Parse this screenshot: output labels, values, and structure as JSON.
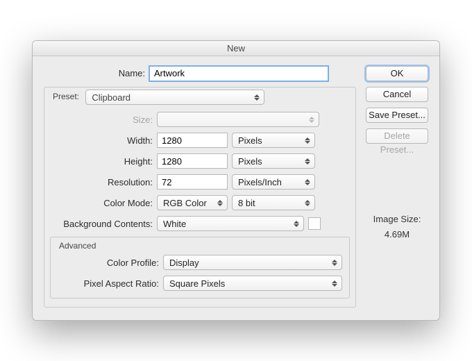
{
  "window": {
    "title": "New"
  },
  "fields": {
    "name_label": "Name:",
    "name_value": "Artwork",
    "preset_legend": "Preset:",
    "preset_value": "Clipboard",
    "size_label": "Size:",
    "size_value": "",
    "width_label": "Width:",
    "width_value": "1280",
    "width_unit": "Pixels",
    "height_label": "Height:",
    "height_value": "1280",
    "height_unit": "Pixels",
    "resolution_label": "Resolution:",
    "resolution_value": "72",
    "resolution_unit": "Pixels/Inch",
    "color_mode_label": "Color Mode:",
    "color_mode_value": "RGB Color",
    "color_depth_value": "8 bit",
    "bg_label": "Background Contents:",
    "bg_value": "White",
    "bg_swatch": "#ffffff",
    "advanced_legend": "Advanced",
    "profile_label": "Color Profile:",
    "profile_value": "Display",
    "par_label": "Pixel Aspect Ratio:",
    "par_value": "Square Pixels"
  },
  "buttons": {
    "ok": "OK",
    "cancel": "Cancel",
    "save_preset": "Save Preset...",
    "delete_preset": "Delete Preset..."
  },
  "info": {
    "image_size_label": "Image Size:",
    "image_size_value": "4.69M"
  }
}
